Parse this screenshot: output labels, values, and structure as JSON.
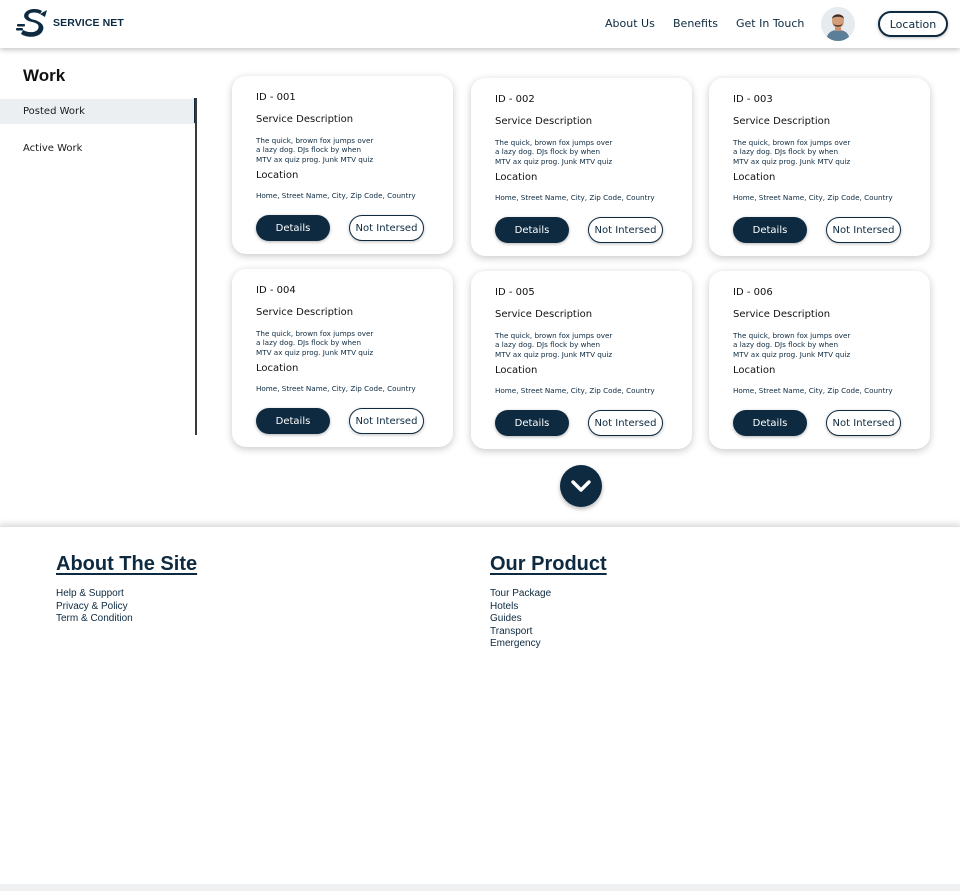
{
  "brand": {
    "name": "SERVICE NET",
    "color": "#0d2a40"
  },
  "nav": {
    "items": [
      "About Us",
      "Benefits",
      "Get In Touch"
    ],
    "location_button": "Location"
  },
  "sidebar": {
    "title": "Work",
    "items": [
      {
        "label": "Posted Work",
        "active": true
      },
      {
        "label": "Active Work",
        "active": false
      }
    ]
  },
  "cards": [
    {
      "id": "ID - 001",
      "desc_heading": "Service Description",
      "desc_lines": [
        "The quick, brown fox jumps over",
        "a lazy dog. DJs flock by when",
        "MTV ax quiz prog. Junk MTV quiz"
      ],
      "loc_heading": "Location",
      "location": "Home, Street Name, City, Zip Code, Country",
      "details_label": "Details",
      "not_interested_label": "Not Intersed"
    },
    {
      "id": "ID - 002",
      "desc_heading": "Service Description",
      "desc_lines": [
        "The quick, brown fox jumps over",
        "a lazy dog. DJs flock by when",
        "MTV ax quiz prog. Junk MTV quiz"
      ],
      "loc_heading": "Location",
      "location": "Home, Street Name, City, Zip Code, Country",
      "details_label": "Details",
      "not_interested_label": "Not Intersed"
    },
    {
      "id": "ID - 003",
      "desc_heading": "Service Description",
      "desc_lines": [
        "The quick, brown fox jumps over",
        "a lazy dog. DJs flock by when",
        "MTV ax quiz prog. Junk MTV quiz"
      ],
      "loc_heading": "Location",
      "location": "Home, Street Name, City, Zip Code, Country",
      "details_label": "Details",
      "not_interested_label": "Not Intersed"
    },
    {
      "id": "ID - 004",
      "desc_heading": "Service Description",
      "desc_lines": [
        "The quick, brown fox jumps over",
        "a lazy dog. DJs flock by when",
        "MTV ax quiz prog. Junk MTV quiz"
      ],
      "loc_heading": "Location",
      "location": "Home, Street Name, City, Zip Code, Country",
      "details_label": "Details",
      "not_interested_label": "Not Intersed"
    },
    {
      "id": "ID - 005",
      "desc_heading": "Service Description",
      "desc_lines": [
        "The quick, brown fox jumps over",
        "a lazy dog. DJs flock by when",
        "MTV ax quiz prog. Junk MTV quiz"
      ],
      "loc_heading": "Location",
      "location": "Home, Street Name, City, Zip Code, Country",
      "details_label": "Details",
      "not_interested_label": "Not Intersed"
    },
    {
      "id": "ID - 006",
      "desc_heading": "Service Description",
      "desc_lines": [
        "The quick, brown fox jumps over",
        "a lazy dog. DJs flock by when",
        "MTV ax quiz prog. Junk MTV quiz"
      ],
      "loc_heading": "Location",
      "location": "Home, Street Name, City, Zip Code, Country",
      "details_label": "Details",
      "not_interested_label": "Not Intersed"
    }
  ],
  "load_more_icon": "chevron-down-icon",
  "footer": {
    "about": {
      "title": "About The Site",
      "links": [
        "Help & Support",
        "Privacy & Policy",
        "Term & Condition"
      ]
    },
    "product": {
      "title": "Our Product",
      "links": [
        "Tour Package",
        "Hotels",
        "Guides",
        "Transport",
        "Emergency"
      ]
    }
  }
}
